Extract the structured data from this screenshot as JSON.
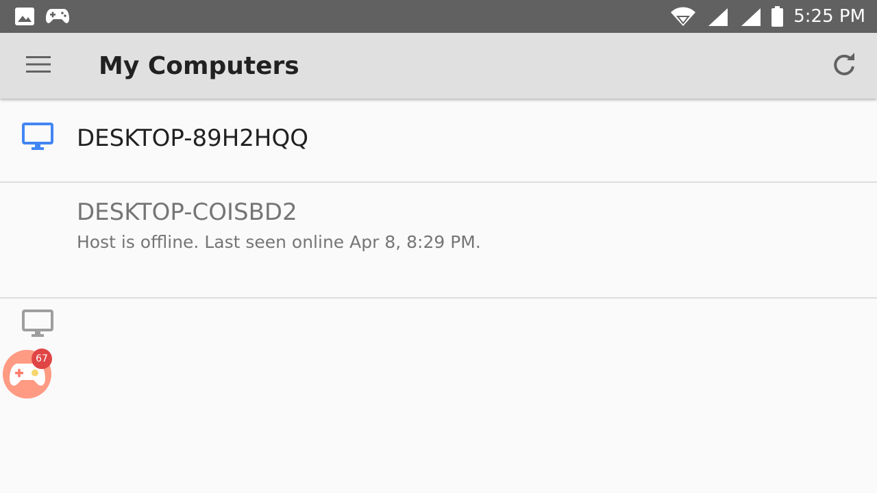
{
  "status_bar": {
    "time": "5:25 PM",
    "icons": [
      "image-icon",
      "gamepad-icon",
      "wifi-icon",
      "signal-icon",
      "signal-icon",
      "battery-icon"
    ]
  },
  "app_bar": {
    "title": "My Computers",
    "left_icon": "menu-icon",
    "right_icon": "refresh-icon"
  },
  "hosts": [
    {
      "name": "DESKTOP-89H2HQQ",
      "status": "",
      "online": true,
      "icon": "monitor-icon",
      "icon_color": "#4285f4"
    },
    {
      "name": "DESKTOP-COISBD2",
      "status": "Host is offline.  Last seen online Apr 8, 8:29 PM.",
      "online": false,
      "icon": "monitor-icon",
      "icon_color": "#9e9e9e"
    }
  ],
  "floating_bubble": {
    "icon": "gamepad-icon",
    "badge": "67"
  },
  "colors": {
    "status_bar": "#616161",
    "app_bar": "#e0e0e0",
    "background": "#fafafa",
    "online_icon": "#4285f4",
    "offline_icon": "#9e9e9e",
    "bubble": "#ff9a83",
    "badge": "#e04545"
  }
}
